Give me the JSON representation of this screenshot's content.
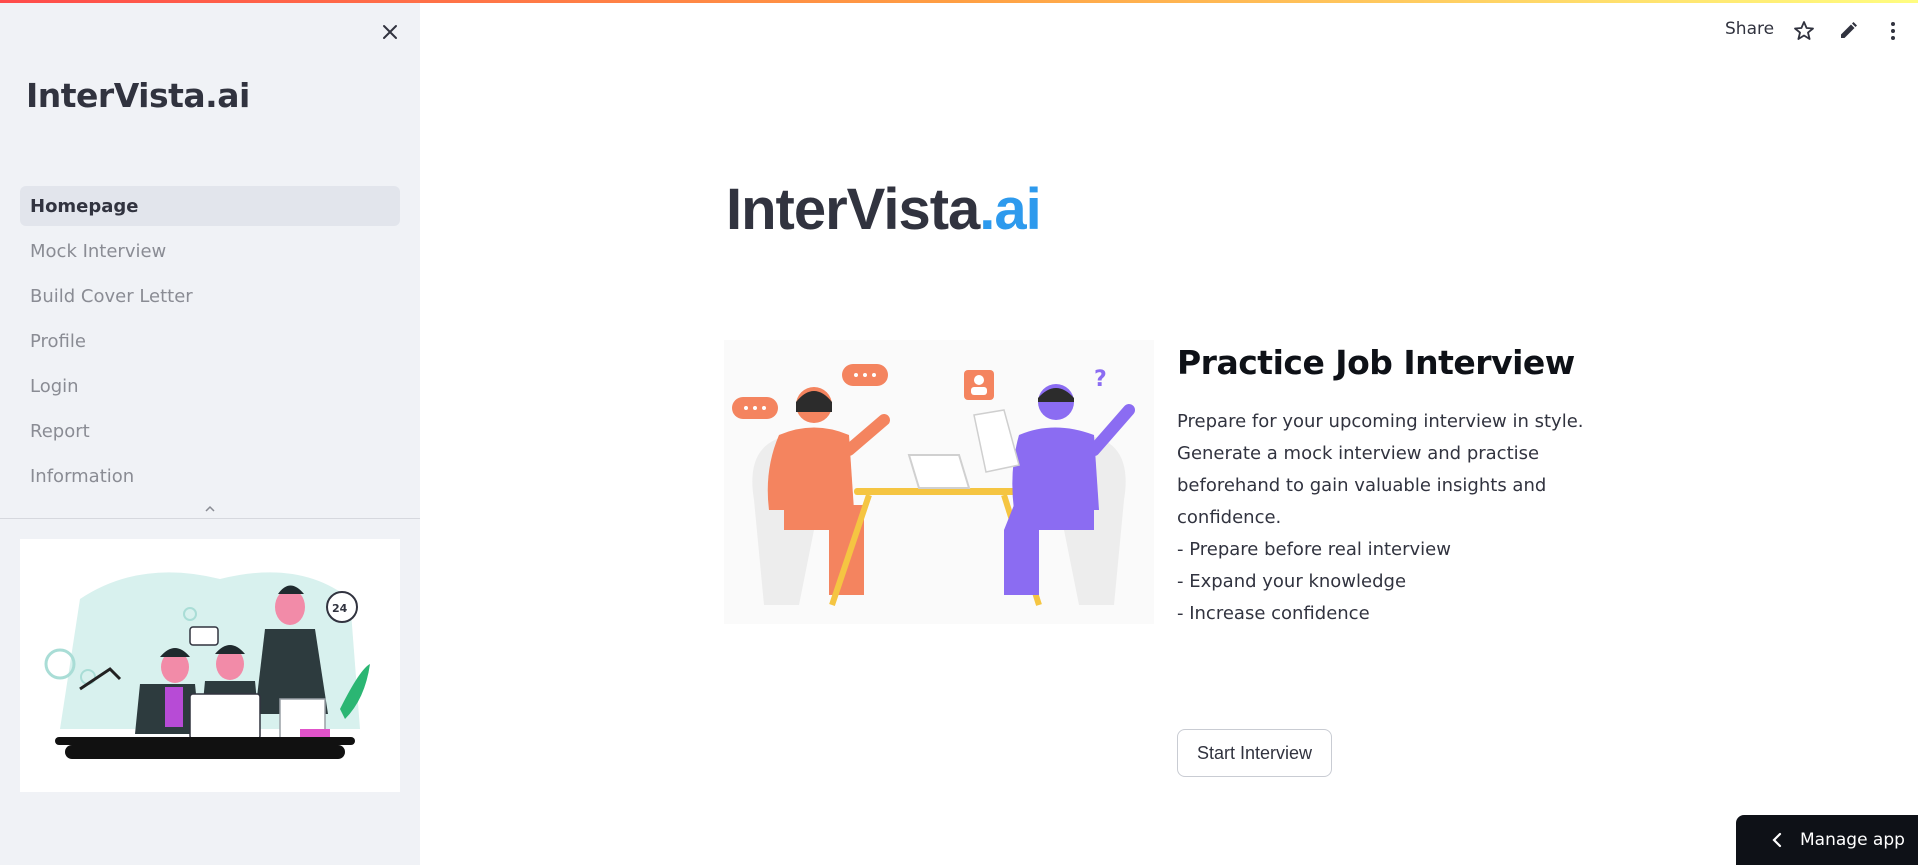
{
  "sidebar": {
    "brand": "InterVista.ai",
    "nav_items": [
      {
        "label": "Homepage",
        "active": true
      },
      {
        "label": "Mock Interview",
        "active": false
      },
      {
        "label": "Build Cover Letter",
        "active": false
      },
      {
        "label": "Profile",
        "active": false
      },
      {
        "label": "Login",
        "active": false
      },
      {
        "label": "Report",
        "active": false
      },
      {
        "label": "Information",
        "active": false
      }
    ],
    "close_icon": "close-icon",
    "collapse_icon": "chevron-up-icon"
  },
  "header": {
    "share_label": "Share",
    "icons": [
      "star-icon",
      "pencil-icon",
      "more-vertical-icon"
    ]
  },
  "main": {
    "title_prefix": "InterVista",
    "title_suffix": ".ai",
    "section_title": "Practice Job Interview",
    "description_lines": [
      "Prepare for your upcoming interview in style.",
      "Generate a mock interview and practise",
      "beforehand to gain valuable insights and",
      "confidence.",
      "- Prepare before real interview",
      "- Expand your knowledge",
      "- Increase confidence"
    ],
    "start_button": "Start Interview"
  },
  "footer": {
    "manage_app_label": "Manage app"
  },
  "colors": {
    "accent": "#2e9aed",
    "sidebar_bg": "#f0f2f6",
    "text": "#31333f",
    "illustration_orange": "#f4845f",
    "illustration_purple": "#8b6cf2"
  }
}
